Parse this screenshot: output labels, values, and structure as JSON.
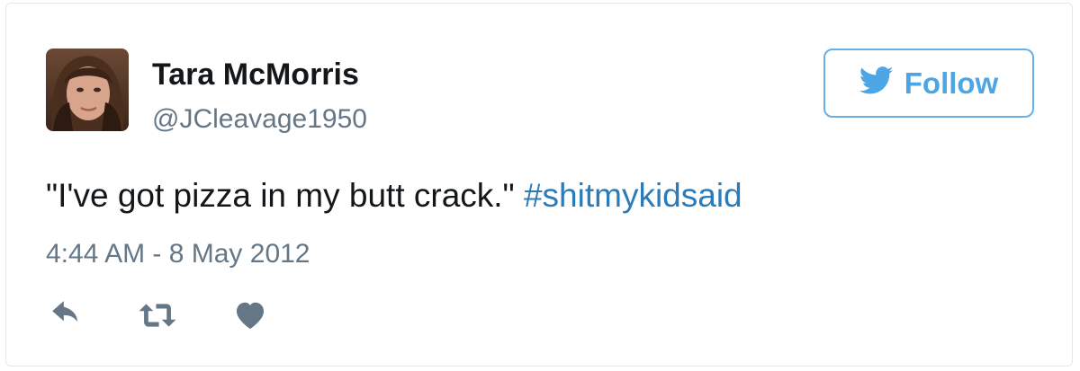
{
  "tweet": {
    "author_name": "Tara McMorris",
    "author_handle": "@JCleavage1950",
    "text": "\"I've got pizza in my butt crack.\"",
    "hashtag": "#shitmykidsaid",
    "timestamp": "4:44 AM - 8 May 2012"
  },
  "follow_button": {
    "label": "Follow",
    "icon": "twitter-bird-icon"
  },
  "actions": {
    "reply_icon": "reply-icon",
    "retweet_icon": "retweet-icon",
    "like_icon": "heart-icon"
  },
  "colors": {
    "accent": "#4ca6e6",
    "link": "#2b7bb9",
    "muted": "#657786",
    "text": "#14171a",
    "action_icon": "#657786"
  }
}
